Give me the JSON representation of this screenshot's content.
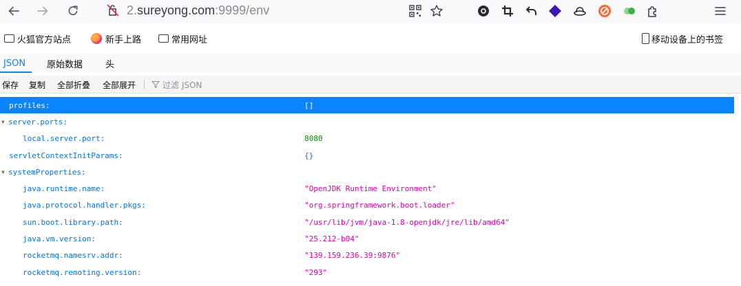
{
  "browser": {
    "url_prefix": "2.",
    "url_domain": "sureyong.com",
    "url_suffix": ":9999/env",
    "icons": {
      "back": "arrow-left-icon",
      "forward": "arrow-right-icon",
      "reload": "reload-icon",
      "identity": "site-permissions-icon",
      "qr": "qr-code-icon",
      "bookmark": "star-icon",
      "menu": "hamburger-menu-icon"
    }
  },
  "bookmarks": {
    "items": [
      "火狐官方站点",
      "新手上路",
      "常用网址"
    ],
    "mobile": "移动设备上的书签"
  },
  "viewer": {
    "tabs": [
      "JSON",
      "原始数据",
      "头"
    ],
    "toolbar": [
      "保存",
      "复制",
      "全部折叠",
      "全部展开"
    ],
    "filter_placeholder": "过滤 JSON"
  },
  "rows": [
    {
      "key": "profiles:",
      "value": "[]",
      "kind": "obj",
      "indent": 1,
      "selected": true
    },
    {
      "key": "server.ports:",
      "value": "",
      "kind": "",
      "indent": 0,
      "expandable": true
    },
    {
      "key": "local.server.port:",
      "value": "8080",
      "kind": "num",
      "indent": 2
    },
    {
      "key": "servletContextInitParams:",
      "value": "{}",
      "kind": "obj",
      "indent": 1
    },
    {
      "key": "systemProperties:",
      "value": "",
      "kind": "",
      "indent": 0,
      "expandable": true
    },
    {
      "key": "java.runtime.name:",
      "value": "\"OpenJDK Runtime Environment\"",
      "kind": "str",
      "indent": 2
    },
    {
      "key": "java.protocol.handler.pkgs:",
      "value": "\"org.springframework.boot.loader\"",
      "kind": "str",
      "indent": 2
    },
    {
      "key": "sun.boot.library.path:",
      "value": "\"/usr/lib/jvm/java-1.8-openjdk/jre/lib/amd64\"",
      "kind": "str",
      "indent": 2
    },
    {
      "key": "java.vm.version:",
      "value": "\"25.212-b04\"",
      "kind": "str",
      "indent": 2
    },
    {
      "key": "rocketmq.namesrv.addr:",
      "value": "\"139.159.236.39:9876\"",
      "kind": "str",
      "indent": 2
    },
    {
      "key": "rocketmq.remoting.version:",
      "value": "\"293\"",
      "kind": "str",
      "indent": 2
    }
  ],
  "colors": {
    "accent": "#0a84ff",
    "key": "#0074e8",
    "number": "#058b00",
    "string": "#dd00a9"
  }
}
